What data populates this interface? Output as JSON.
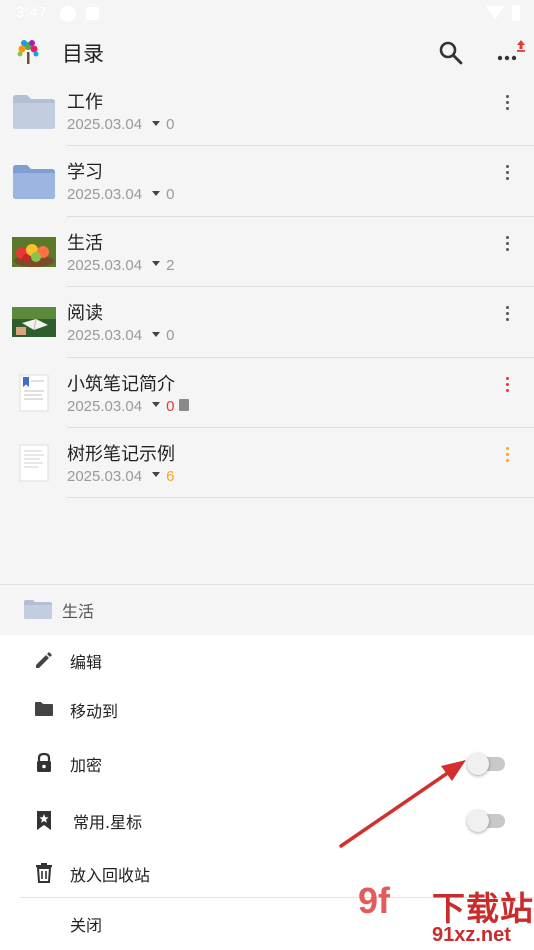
{
  "status_bar": {
    "time": "3:47"
  },
  "app_bar": {
    "title": "目录"
  },
  "items": [
    {
      "title": "工作",
      "date": "2025.03.04",
      "count": "0",
      "count_color": "#9a9a9a",
      "menu_color": "#555555",
      "thumb": "folder",
      "has_doc_icon": false
    },
    {
      "title": "学习",
      "date": "2025.03.04",
      "count": "0",
      "count_color": "#9a9a9a",
      "menu_color": "#555555",
      "thumb": "folder-blue",
      "has_doc_icon": false
    },
    {
      "title": "生活",
      "date": "2025.03.04",
      "count": "2",
      "count_color": "#9a9a9a",
      "menu_color": "#555555",
      "thumb": "photo-fruit",
      "has_doc_icon": false
    },
    {
      "title": "阅读",
      "date": "2025.03.04",
      "count": "0",
      "count_color": "#9a9a9a",
      "menu_color": "#555555",
      "thumb": "photo-reading",
      "has_doc_icon": false
    },
    {
      "title": "小筑笔记简介",
      "date": "2025.03.04",
      "count": "0",
      "count_color": "#e53935",
      "menu_color": "#e53935",
      "thumb": "note-bookmark",
      "has_doc_icon": true
    },
    {
      "title": "树形笔记示例",
      "date": "2025.03.04",
      "count": "6",
      "count_color": "#f5a623",
      "menu_color": "#f5a623",
      "thumb": "note-plain",
      "has_doc_icon": false
    }
  ],
  "sheet": {
    "header_label": "生活",
    "actions": [
      {
        "label": "编辑",
        "icon": "pencil-icon"
      },
      {
        "label": "移动到",
        "icon": "folder-icon"
      },
      {
        "label": "加密",
        "icon": "lock-icon",
        "toggle": false
      },
      {
        "label": "常用.星标",
        "icon": "star-bookmark-icon",
        "toggle": false
      },
      {
        "label": "放入回收站",
        "icon": "trash-icon"
      },
      {
        "label": "关闭",
        "icon": ""
      }
    ]
  },
  "watermark": {
    "mark": "9f",
    "cn": "下载站",
    "url": "91xz.net"
  },
  "colors": {
    "background": "#f5f5f5",
    "sheet": "#ffffff",
    "accent_red": "#e53935",
    "accent_orange": "#f5a623",
    "arrow": "#d32f2f"
  }
}
